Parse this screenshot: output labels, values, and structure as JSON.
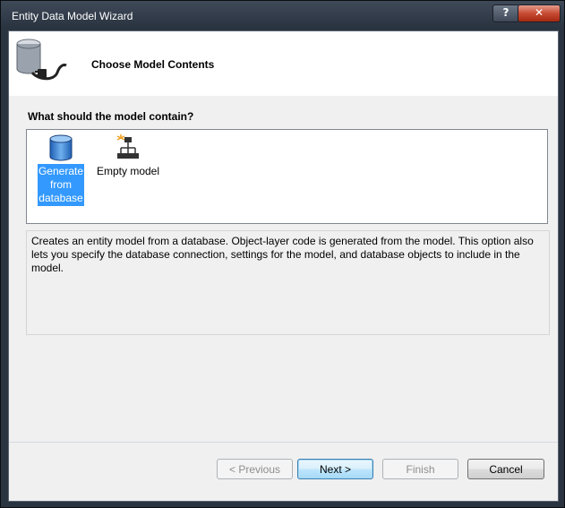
{
  "window": {
    "title": "Entity Data Model Wizard",
    "help_label": "?",
    "close_label": "✕"
  },
  "header": {
    "title": "Choose Model Contents",
    "icon": "database-plug-icon"
  },
  "question": "What should the model contain?",
  "options": [
    {
      "label": "Generate from database",
      "icon": "database-icon",
      "selected": true
    },
    {
      "label": "Empty model",
      "icon": "empty-model-icon",
      "selected": false
    }
  ],
  "description": "Creates an entity model from a database. Object-layer code is generated from the model. This option also lets you specify the database connection, settings for the model, and database objects to include in the model.",
  "buttons": {
    "previous": "< Previous",
    "next": "Next >",
    "finish": "Finish",
    "cancel": "Cancel"
  },
  "colors": {
    "selection": "#3399ff",
    "titlebar": "#2a3340",
    "close_button": "#c74b32"
  }
}
